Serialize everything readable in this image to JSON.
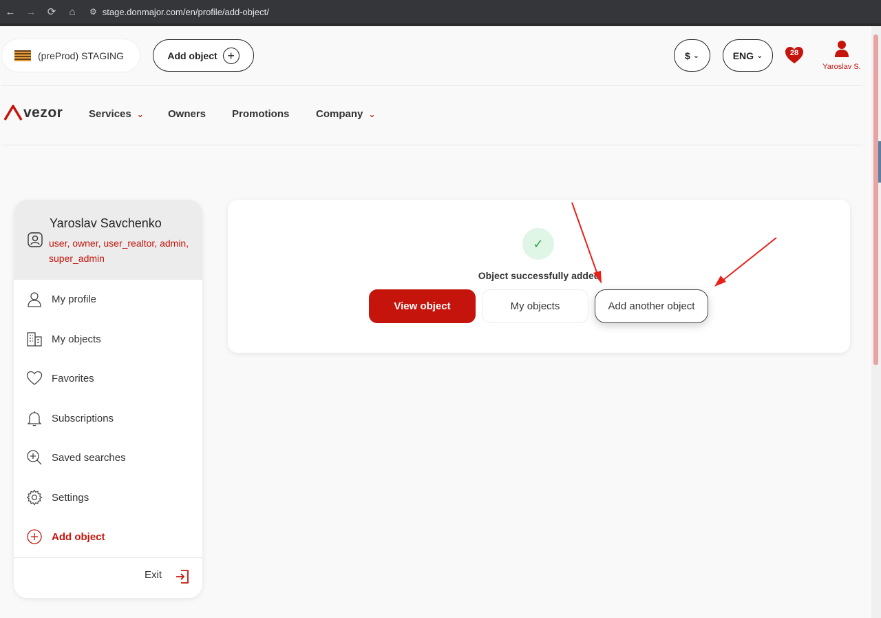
{
  "browser": {
    "url": "stage.donmajor.com/en/profile/add-object/"
  },
  "header": {
    "env_label": "(preProd) STAGING",
    "add_object_label": "Add object",
    "currency_label": "$",
    "language_label": "ENG",
    "favorites_count": "28",
    "user_short": "Yaroslav S."
  },
  "nav": {
    "logo_text": "vezor",
    "items": [
      {
        "label": "Services",
        "has_dropdown": true
      },
      {
        "label": "Owners",
        "has_dropdown": false
      },
      {
        "label": "Promotions",
        "has_dropdown": false
      },
      {
        "label": "Company",
        "has_dropdown": true
      }
    ]
  },
  "sidebar": {
    "user_name": "Yaroslav Savchenko",
    "roles": "user, owner, user_realtor, admin, super_admin",
    "items": [
      {
        "label": "My profile",
        "icon": "person-icon"
      },
      {
        "label": "My objects",
        "icon": "building-icon"
      },
      {
        "label": "Favorites",
        "icon": "heart-icon"
      },
      {
        "label": "Subscriptions",
        "icon": "bell-icon"
      },
      {
        "label": "Saved searches",
        "icon": "zoom-plus-icon"
      },
      {
        "label": "Settings",
        "icon": "gear-icon"
      },
      {
        "label": "Add object",
        "icon": "plus-circle-icon"
      }
    ],
    "exit_label": "Exit"
  },
  "card": {
    "message": "Object successfully added",
    "view_label": "View object",
    "my_objects_label": "My objects",
    "add_another_label": "Add another object"
  },
  "colors": {
    "brand_red": "#c5140b",
    "success_green": "#2aa34a",
    "annotation_arrow": "#e8201a"
  }
}
